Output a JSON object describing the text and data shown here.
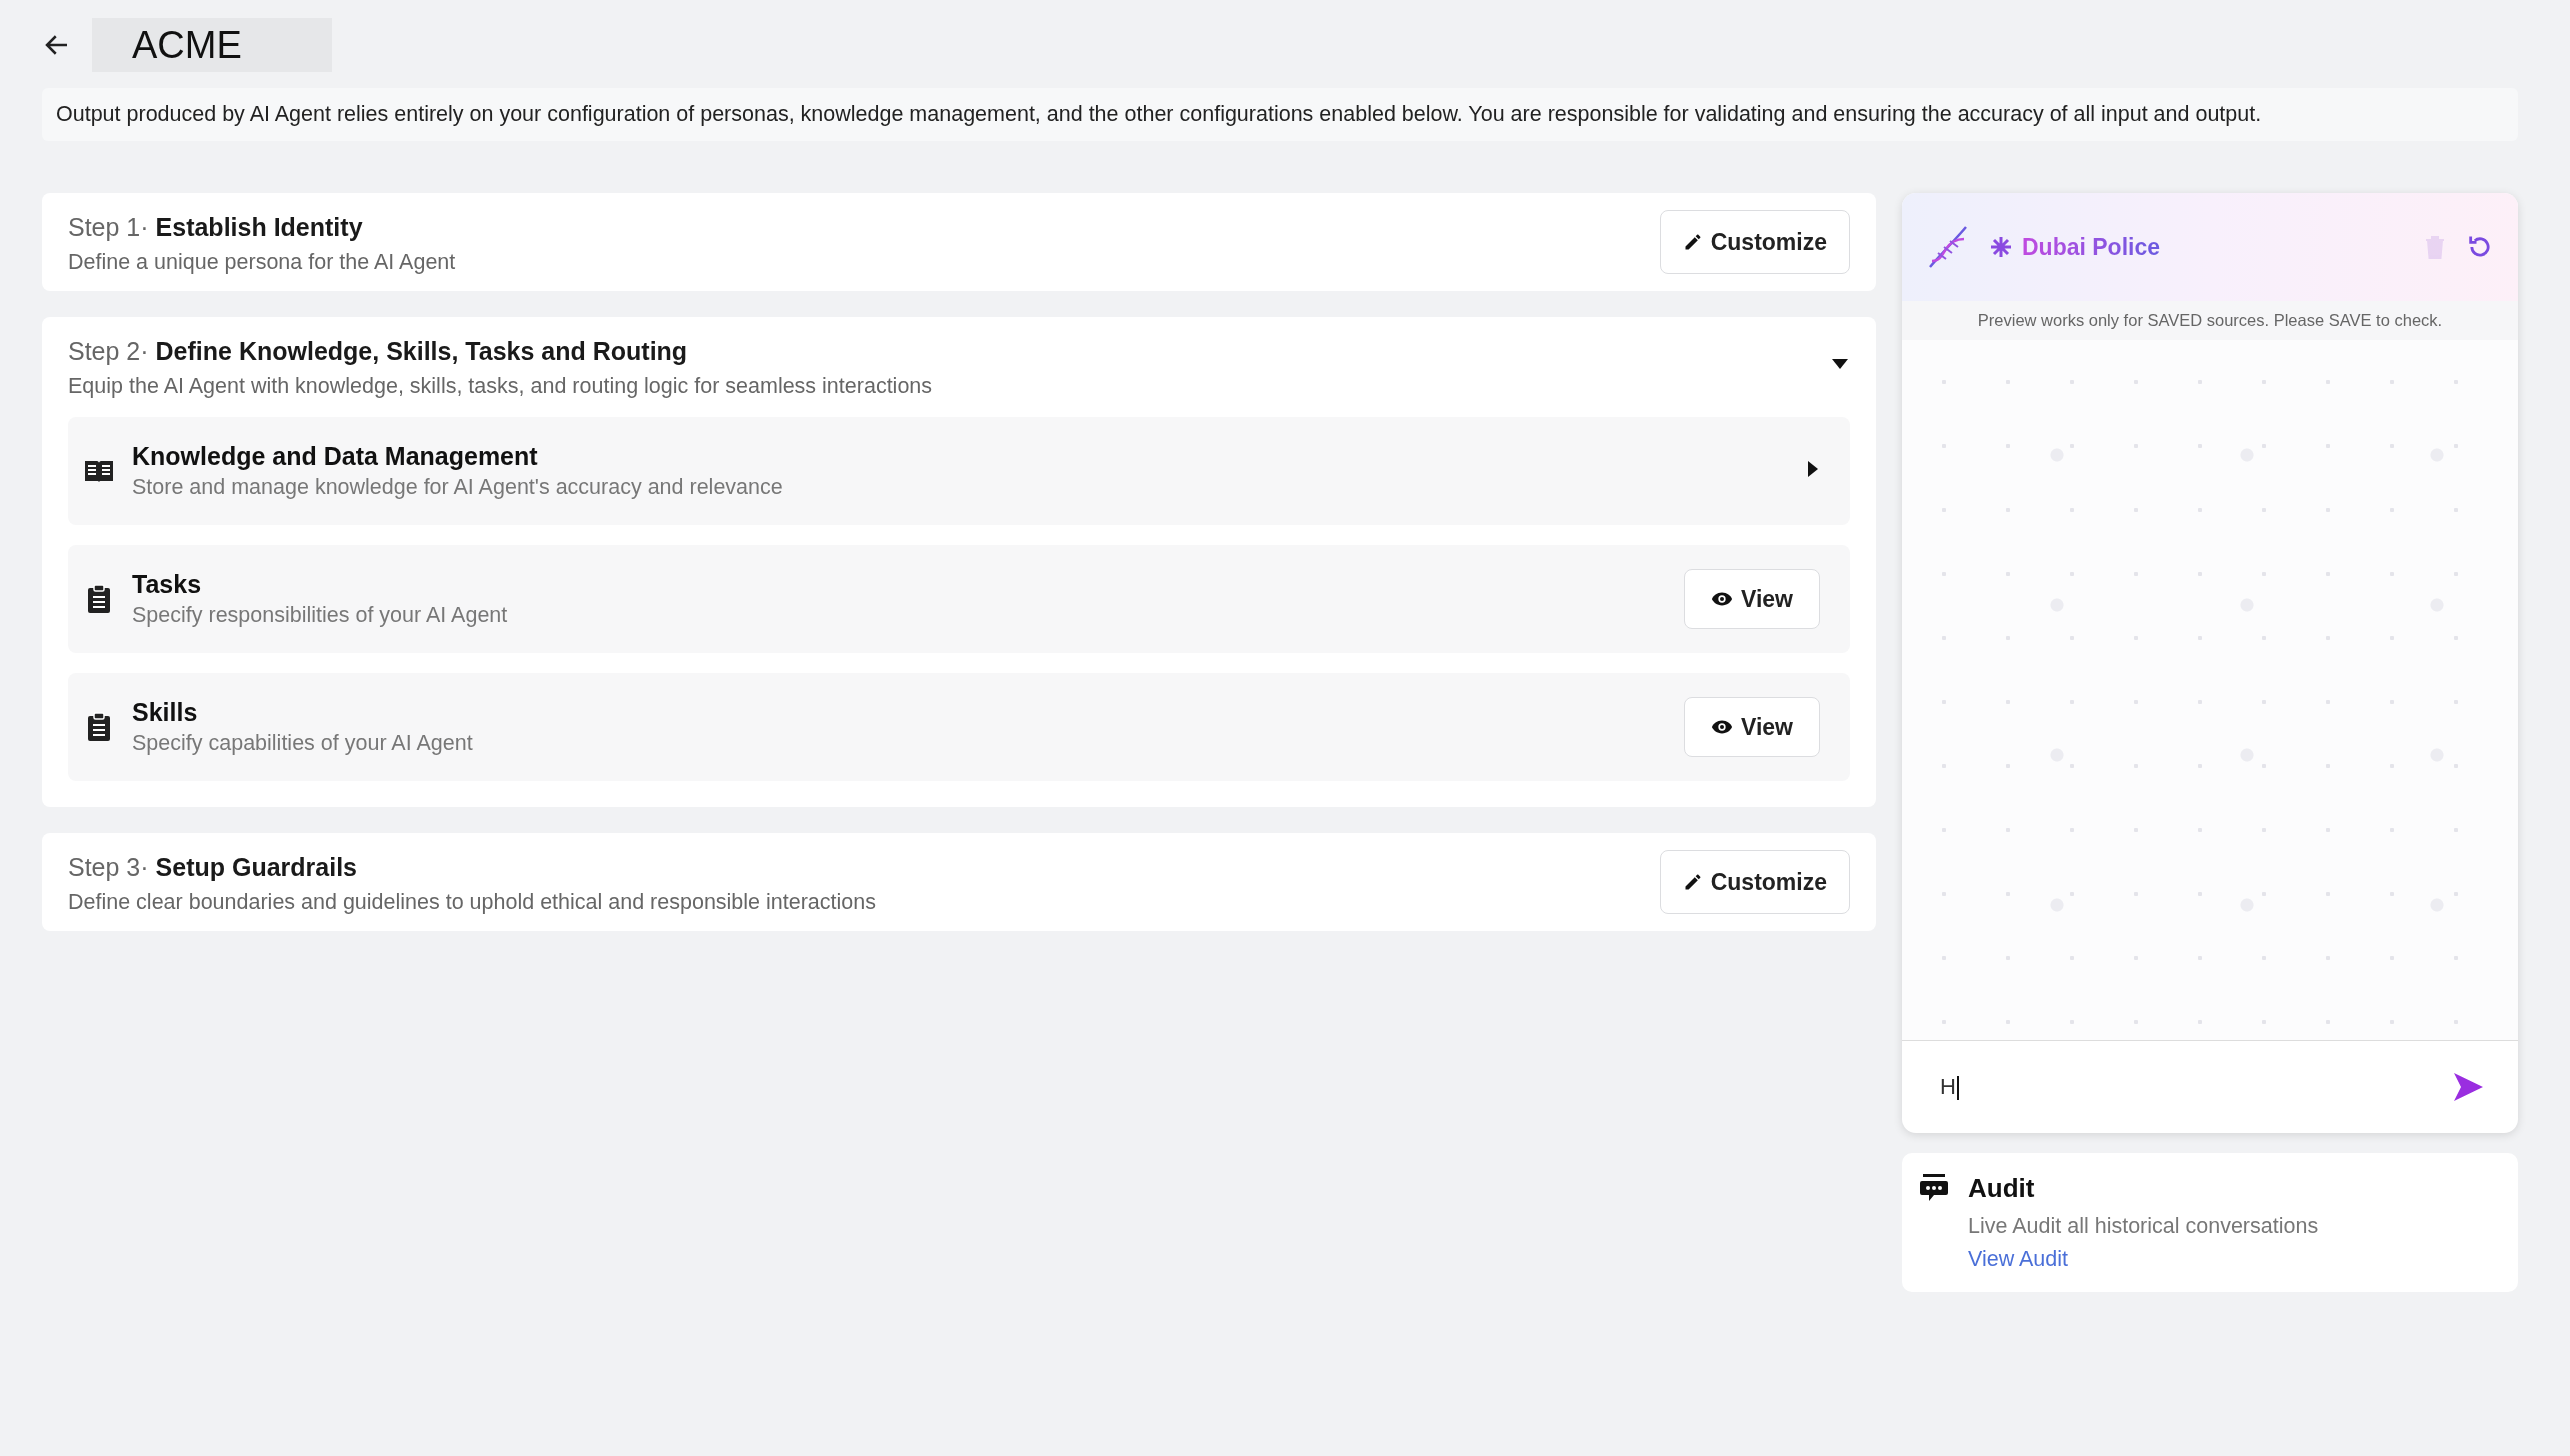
{
  "header": {
    "title": "ACME"
  },
  "disclaimer": "Output produced by AI Agent relies entirely on your configuration of personas, knowledge management, and the other configurations enabled below. You are responsible for validating and ensuring the accuracy of all input and output.",
  "steps": [
    {
      "kind": "action",
      "step": "Step 1·",
      "title": "Establish Identity",
      "description": "Define a unique persona for the AI Agent",
      "button": "Customize"
    },
    {
      "kind": "expandable",
      "step": "Step 2·",
      "title": "Define Knowledge, Skills, Tasks and Routing",
      "description": "Equip the AI Agent with knowledge, skills, tasks, and routing logic for seamless interactions",
      "expanded": true,
      "items": [
        {
          "kind": "expand",
          "title": "Knowledge and Data Management",
          "description": "Store and manage knowledge for AI Agent's accuracy and relevance"
        },
        {
          "kind": "view",
          "title": "Tasks",
          "description": "Specify responsibilities of your AI Agent",
          "button": "View"
        },
        {
          "kind": "view",
          "title": "Skills",
          "description": "Specify capabilities of your AI Agent",
          "button": "View"
        }
      ]
    },
    {
      "kind": "action",
      "step": "Step 3·",
      "title": "Setup Guardrails",
      "description": "Define clear boundaries and guidelines to uphold ethical and responsible interactions",
      "button": "Customize"
    }
  ],
  "preview": {
    "agent_name": "Dubai Police",
    "delete_disabled": true,
    "notice": "Preview works only for SAVED sources. Please SAVE to check.",
    "message": "H"
  },
  "audit": {
    "title": "Audit",
    "description": "Live Audit all historical conversations",
    "link": "View Audit"
  }
}
